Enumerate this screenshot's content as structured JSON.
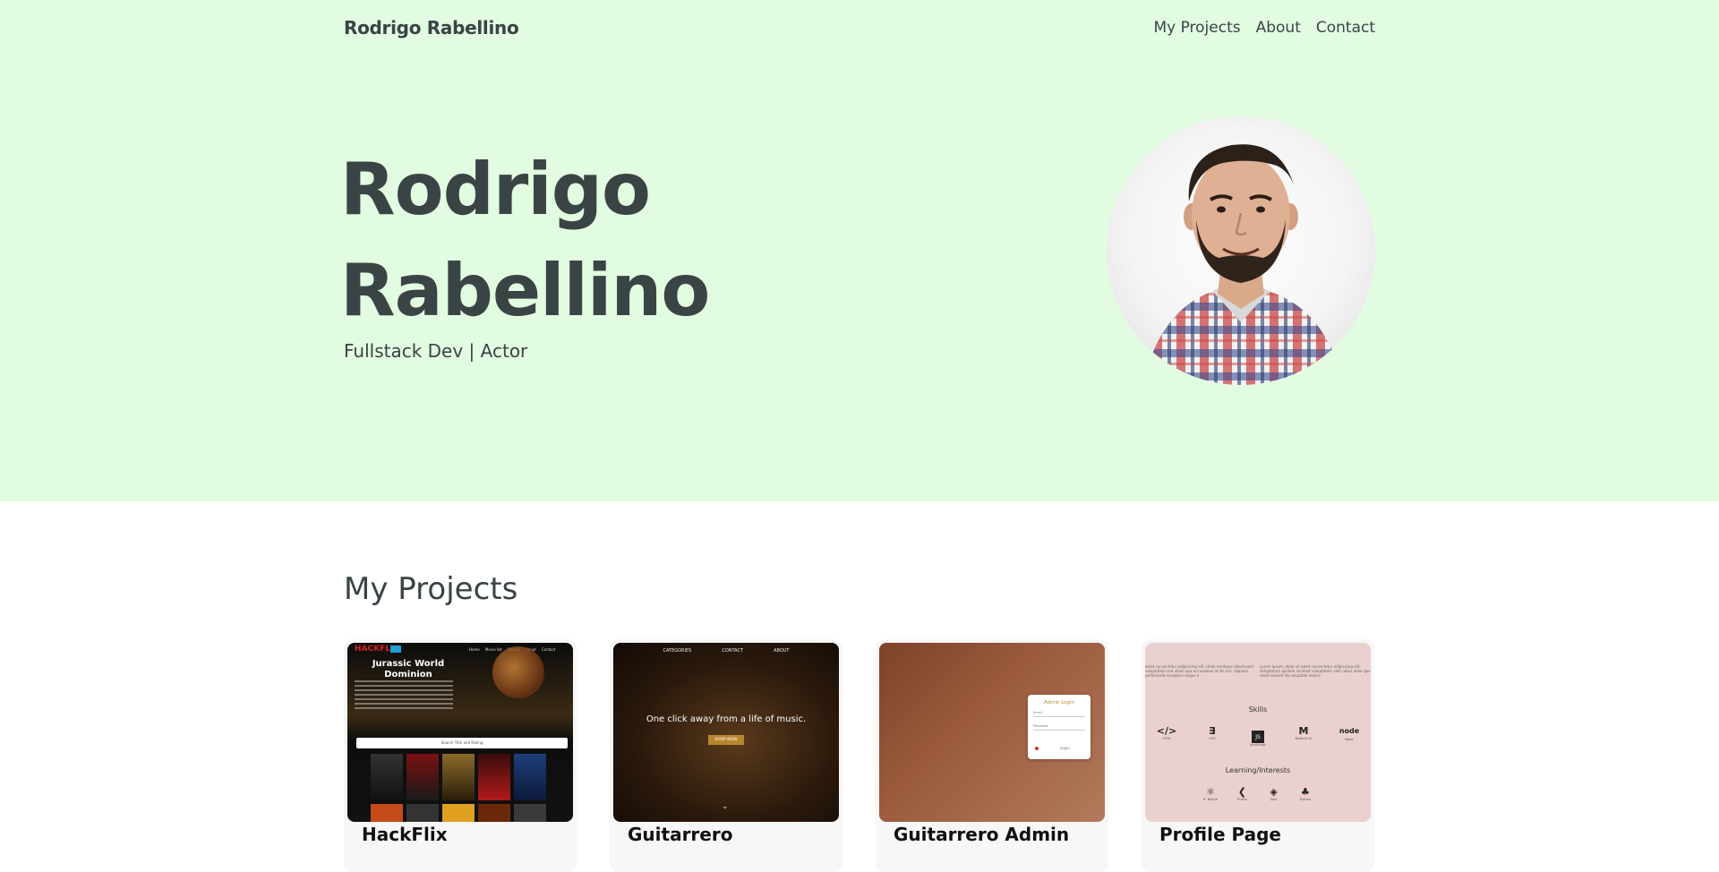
{
  "header": {
    "brand": "Rodrigo Rabellino",
    "nav": [
      "My Projects",
      "About",
      "Contact"
    ]
  },
  "hero": {
    "name_line1": "Rodrigo",
    "name_line2": "Rabellino",
    "subtitle": "Fullstack Dev | Actor"
  },
  "projects": {
    "title": "My Projects",
    "items": [
      {
        "title": "HackFlix",
        "thumb": {
          "logo": "HACKFLIX",
          "nav": [
            "Home",
            "Movie list",
            "Genres",
            "About",
            "Contact"
          ],
          "headline": "Jurassic World Dominion",
          "search": "Search Title and Rating"
        }
      },
      {
        "title": "Guitarrero",
        "thumb": {
          "nav": [
            "CATEGORIES",
            "CONTACT",
            "ABOUT"
          ],
          "headline": "One click away from a life of music.",
          "cta": "SHOP NOW"
        }
      },
      {
        "title": "Guitarrero Admin",
        "thumb": {
          "panel_title": "Admin Login",
          "email_label": "Email",
          "password_label": "Password",
          "button": "Login"
        }
      },
      {
        "title": "Profile Page",
        "thumb": {
          "lorem_left": "amet consectetur adipisicing elit. Unde similique laboriosam voluptatem sed ullam quo accusamus at illo nisi. aliquam perferendis excepturi neque a",
          "lorem_right": "Lorem ipsum, dolor sit amet consectetur adipisicing elit. Voluptatum quidem incidunt voluptatem velit natus dolor quo modi eveniet illo voluptate dolore.",
          "skills_title": "Skills",
          "skills": [
            "HTML",
            "CSS",
            "JavaScript",
            "Material UI",
            "Node"
          ],
          "interests_title": "Learning/Interests",
          "interests": [
            "R. Native",
            "Flutter",
            "Dart",
            "Python"
          ]
        }
      }
    ]
  },
  "colors": {
    "hero_bg": "#e2fce2",
    "text": "#3a4444",
    "page_bg": "#ffffff"
  }
}
